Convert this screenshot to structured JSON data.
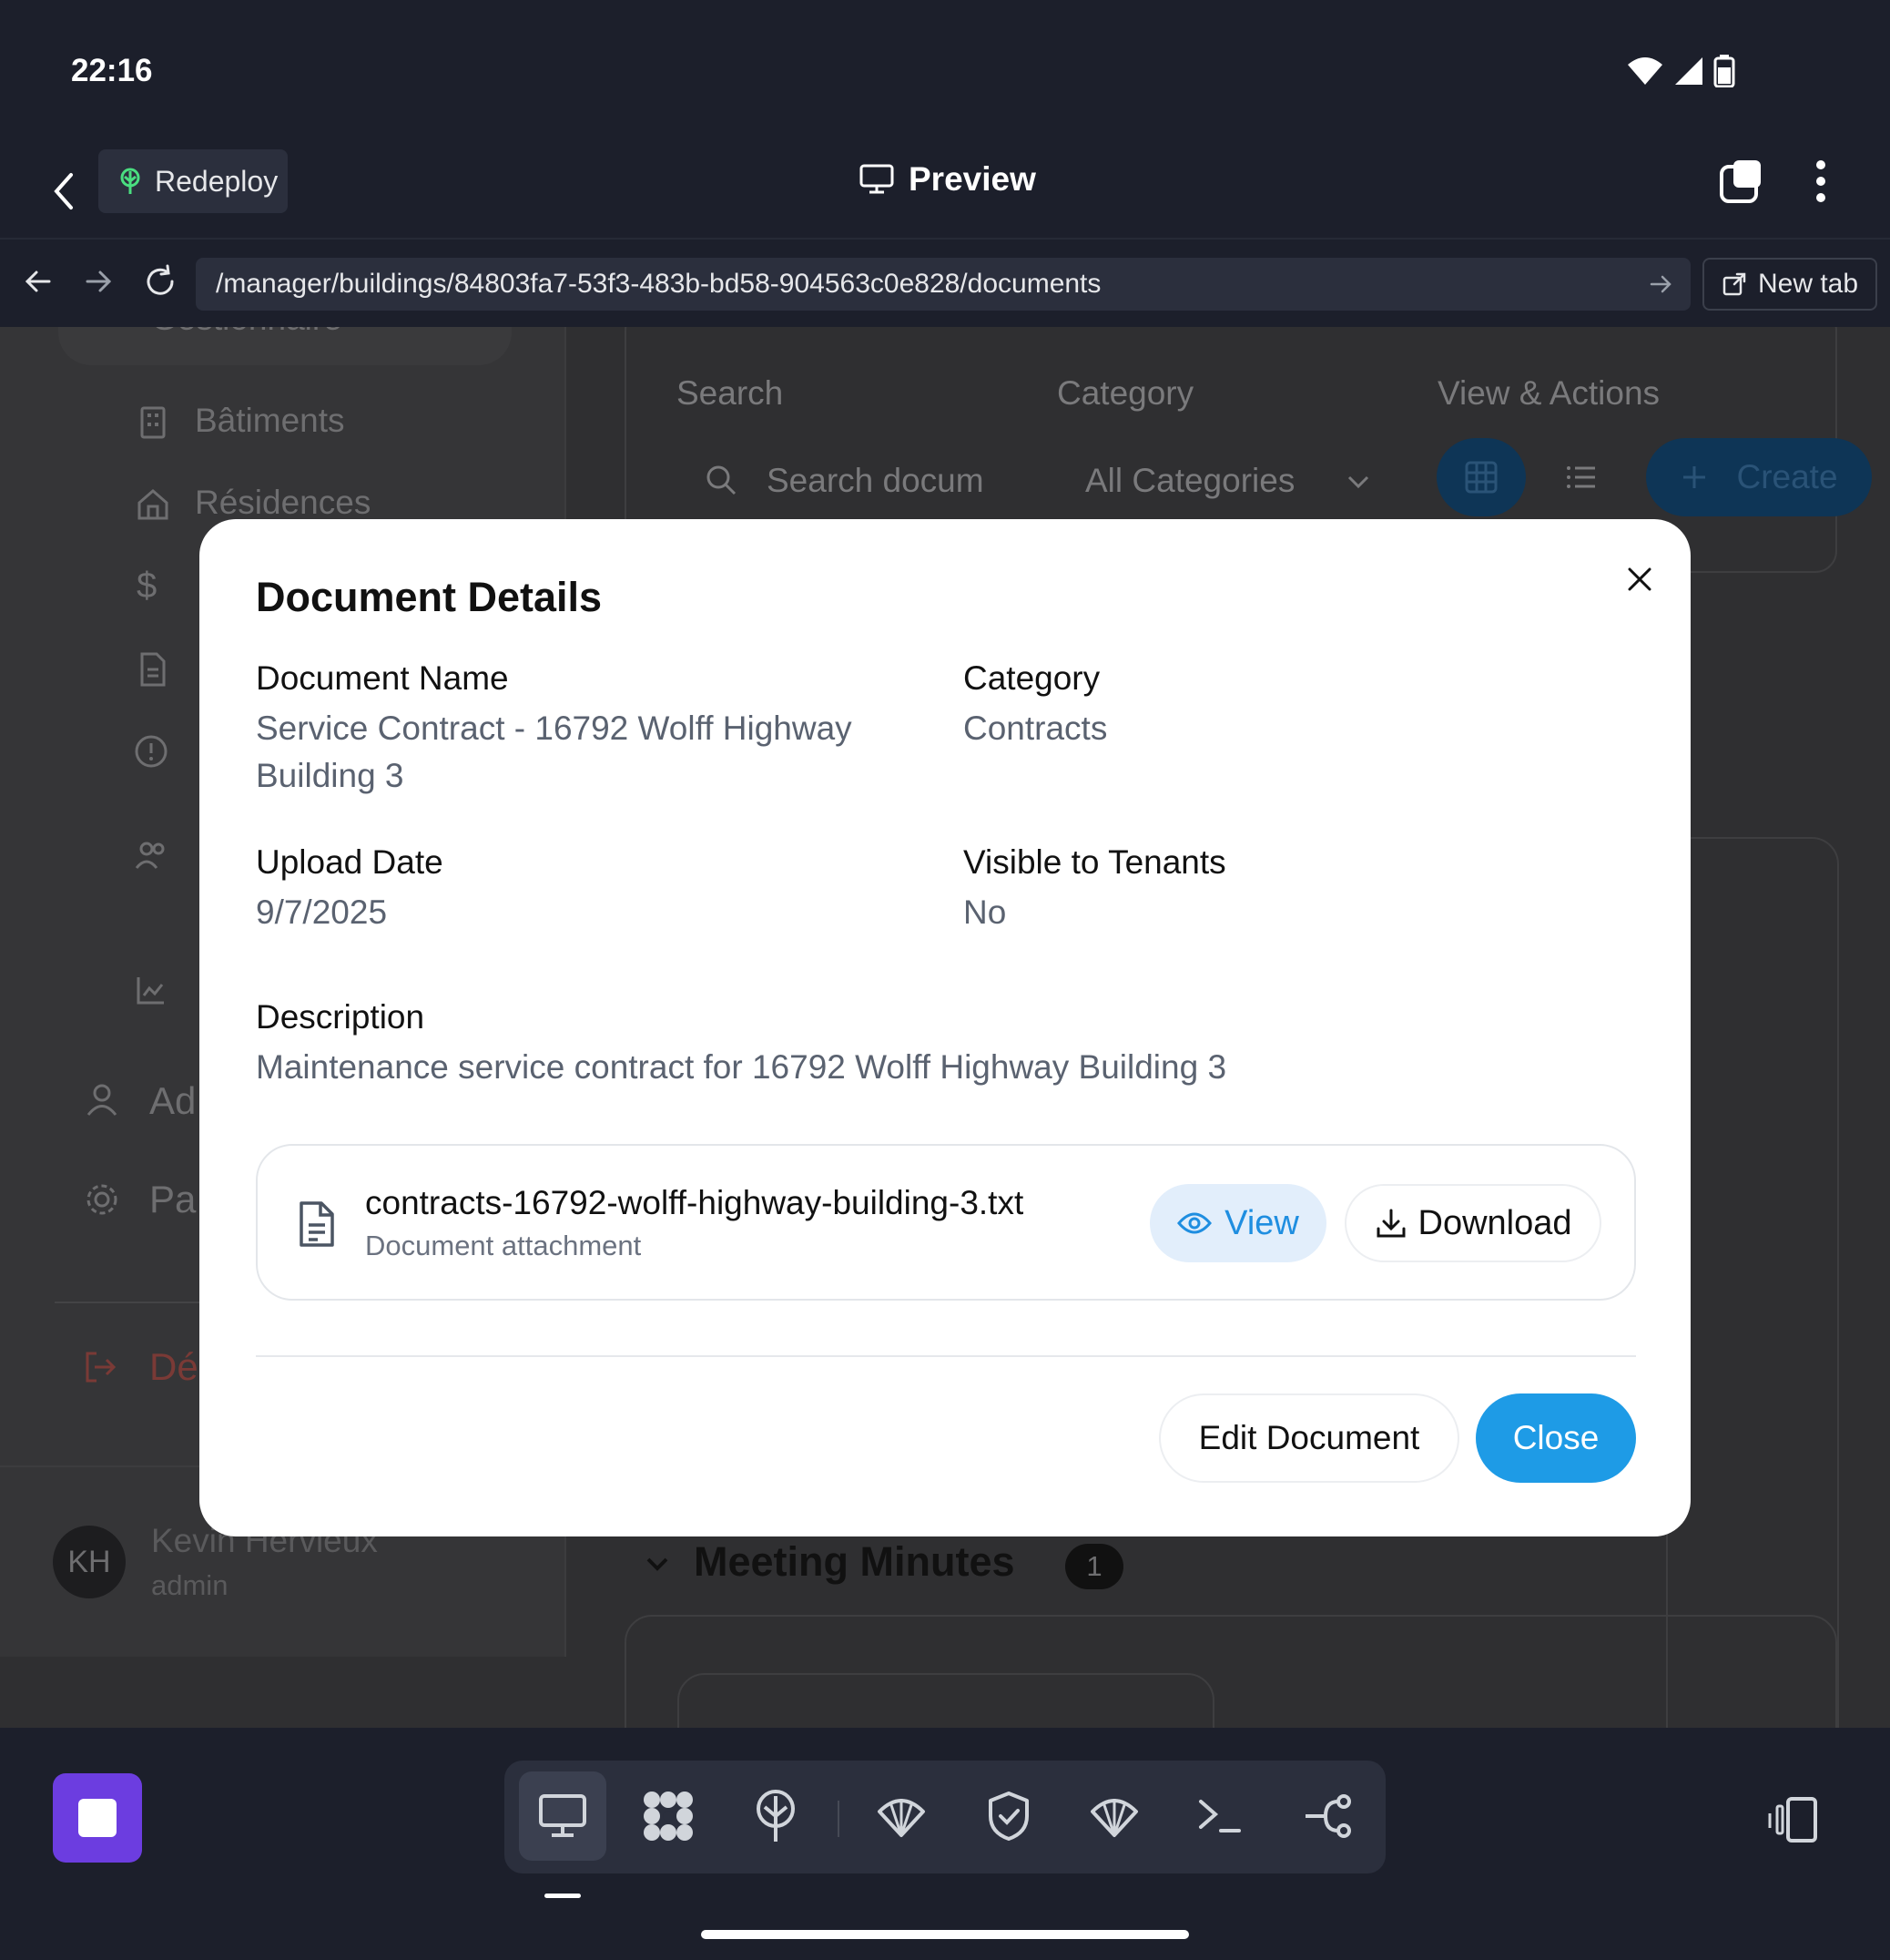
{
  "status_bar": {
    "time": "22:16"
  },
  "app_header": {
    "redeploy_label": "Redeploy",
    "title": "Preview"
  },
  "browser": {
    "url": "/manager/buildings/84803fa7-53f3-483b-bd58-904563c0e828/documents",
    "new_tab_label": "New tab"
  },
  "background": {
    "sidebar": {
      "group_label": "Gestionnaire",
      "items": [
        "Bâtiments",
        "Résidences"
      ],
      "admin_label": "Ad",
      "params_label": "Pa",
      "logout_label": "Dé",
      "user": {
        "initials": "KH",
        "name": "Kevin Hervieux",
        "role": "admin"
      }
    },
    "filters": {
      "search_label": "Search",
      "search_placeholder": "Search docum",
      "category_label": "Category",
      "category_value": "All Categories",
      "actions_label": "View & Actions",
      "create_label": "Create"
    },
    "section": {
      "title": "Meeting Minutes",
      "count": "1"
    }
  },
  "modal": {
    "title": "Document Details",
    "document_name_label": "Document Name",
    "document_name_line1": "Service Contract - 16792 Wolff Highway",
    "document_name_line2": "Building 3",
    "category_label": "Category",
    "category_value": "Contracts",
    "upload_date_label": "Upload Date",
    "upload_date_value": "9/7/2025",
    "visible_label": "Visible to Tenants",
    "visible_value": "No",
    "description_label": "Description",
    "description_value": "Maintenance service contract for 16792 Wolff Highway Building 3",
    "attachment": {
      "file_name": "contracts-16792-wolff-highway-building-3.txt",
      "subtitle": "Document attachment",
      "view_label": "View",
      "download_label": "Download"
    },
    "edit_label": "Edit Document",
    "close_label": "Close"
  },
  "colors": {
    "accent": "#1e9be6",
    "stop_button": "#6c3de0",
    "view_bg": "#e2eefb"
  }
}
